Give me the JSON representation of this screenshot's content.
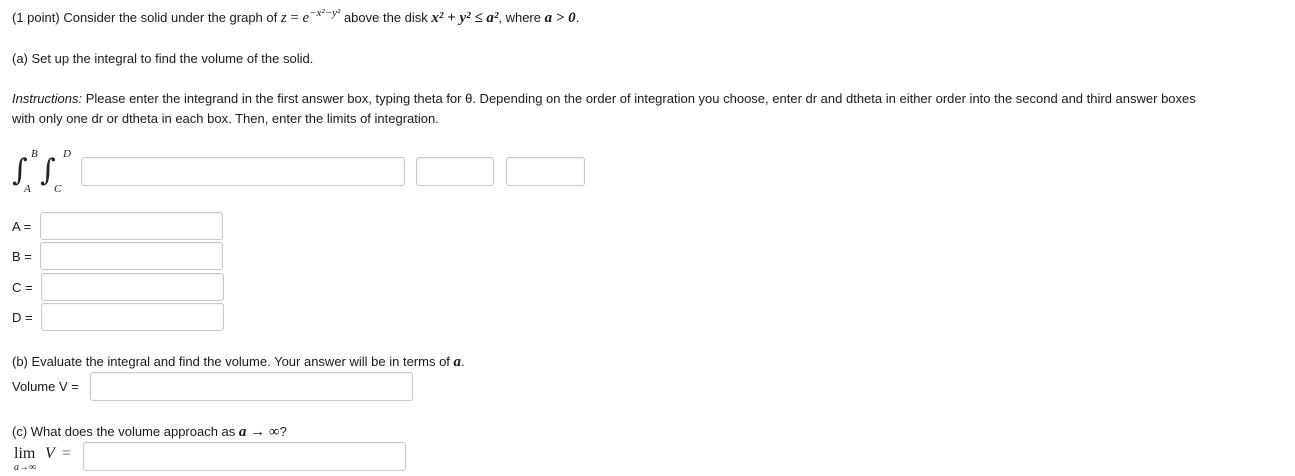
{
  "problem": {
    "points": "(1 point)",
    "intro_text": "Consider the solid under the graph of",
    "function_lhs": "z",
    "function_base": "e",
    "function_exponent": "−x²−y²",
    "region_text": "above the disk",
    "disk_math": "x² + y² ≤ a²",
    "where_text": ", where",
    "condition_math": "a > 0",
    "period": "."
  },
  "part_a": {
    "prompt": "(a) Set up the integral to find the volume of the solid.",
    "instructions_label": "Instructions:",
    "instructions_line1": "Please enter the integrand in the first answer box, typing theta for θ. Depending on the order of integration you choose, enter dr and dtheta in either order into the second and third answer boxes",
    "instructions_line2": "with only one dr or dtheta in each box. Then, enter the limits of integration.",
    "integral": {
      "outer_upper": "B",
      "outer_lower": "A",
      "inner_upper": "D",
      "inner_lower": "C",
      "integrand_value": "",
      "differential1_value": "",
      "differential2_value": ""
    },
    "limits": [
      {
        "label": "A =",
        "value": ""
      },
      {
        "label": "B =",
        "value": ""
      },
      {
        "label": "C =",
        "value": ""
      },
      {
        "label": "D =",
        "value": ""
      }
    ]
  },
  "part_b": {
    "prompt_text": "(b) Evaluate the integral and find the volume. Your answer will be in terms of",
    "prompt_var": "a",
    "prompt_end": ".",
    "volume_label": "Volume V =",
    "volume_value": ""
  },
  "part_c": {
    "prompt_text": "(c) What does the volume approach as",
    "prompt_math": "a → ∞",
    "prompt_end": "?",
    "lim_label": "lim",
    "lim_var": "V",
    "lim_eq": "=",
    "lim_sub": "a→∞",
    "lim_value": ""
  }
}
